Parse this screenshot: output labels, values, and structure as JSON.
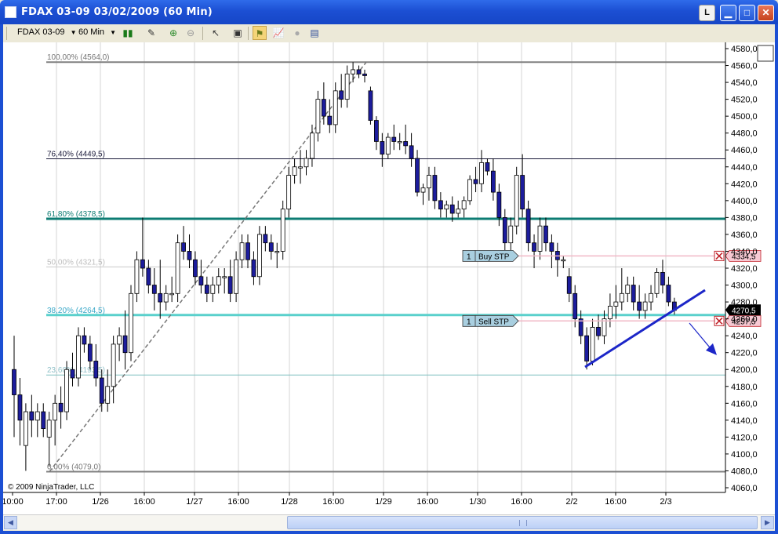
{
  "window": {
    "title": "FDAX 03-09  03/02/2009 (60 Min)",
    "btn_l": "L"
  },
  "toolbar": {
    "instrument": "FDAX 03-09",
    "interval": "60 Min"
  },
  "chart_data": {
    "type": "candlestick",
    "price_axis": {
      "labels": [
        "4580,0",
        "4560,0",
        "4540,0",
        "4520,0",
        "4500,0",
        "4480,0",
        "4460,0",
        "4440,0",
        "4420,0",
        "4400,0",
        "4380,0",
        "4360,0",
        "4340,0",
        "4320,0",
        "4300,0",
        "4280,0",
        "4260,0",
        "4240,0",
        "4220,0",
        "4200,0",
        "4180,0",
        "4160,0",
        "4140,0",
        "4120,0",
        "4100,0",
        "4080,0",
        "4060,0"
      ],
      "min": 4060,
      "max": 4580
    },
    "time_axis": {
      "labels": [
        "10:00",
        "17:00",
        "1/26",
        "16:00",
        "1/27",
        "16:00",
        "1/28",
        "16:00",
        "1/29",
        "16:00",
        "1/30",
        "16:00",
        "2/2",
        "16:00",
        "2/3"
      ]
    },
    "fib_levels": [
      {
        "label": "100,00% (4564,0)",
        "value": 4564.0,
        "color": "#808080"
      },
      {
        "label": "76,40% (4449,5)",
        "value": 4449.5,
        "color": "#1a1a3a"
      },
      {
        "label": "61,80% (4378,5)",
        "value": 4378.5,
        "color": "#0d7c73"
      },
      {
        "label": "50,00% (4321,5)",
        "value": 4321.5,
        "color": "#c8c8c8"
      },
      {
        "label": "38,20% (4264,5)",
        "value": 4264.5,
        "color": "#5ad0cc"
      },
      {
        "label": "23,60% (4193,5)",
        "value": 4193.5,
        "color": "#7fbfbf"
      },
      {
        "label": "0,00% (4079,0)",
        "value": 4079.0,
        "color": "#808080"
      }
    ],
    "orders": [
      {
        "qty": "1",
        "label": "Buy STP",
        "price": 4334.5,
        "price_label": "4334,5"
      },
      {
        "qty": "1",
        "label": "Sell STP",
        "price": 4257.5,
        "price_label": "4257,5"
      }
    ],
    "last_price": {
      "value": 4270.5,
      "label": "4270,5"
    },
    "copyright": "© 2009 NinjaTrader, LLC",
    "up_color": "#ffffff",
    "down_color": "#1c1c9c"
  }
}
